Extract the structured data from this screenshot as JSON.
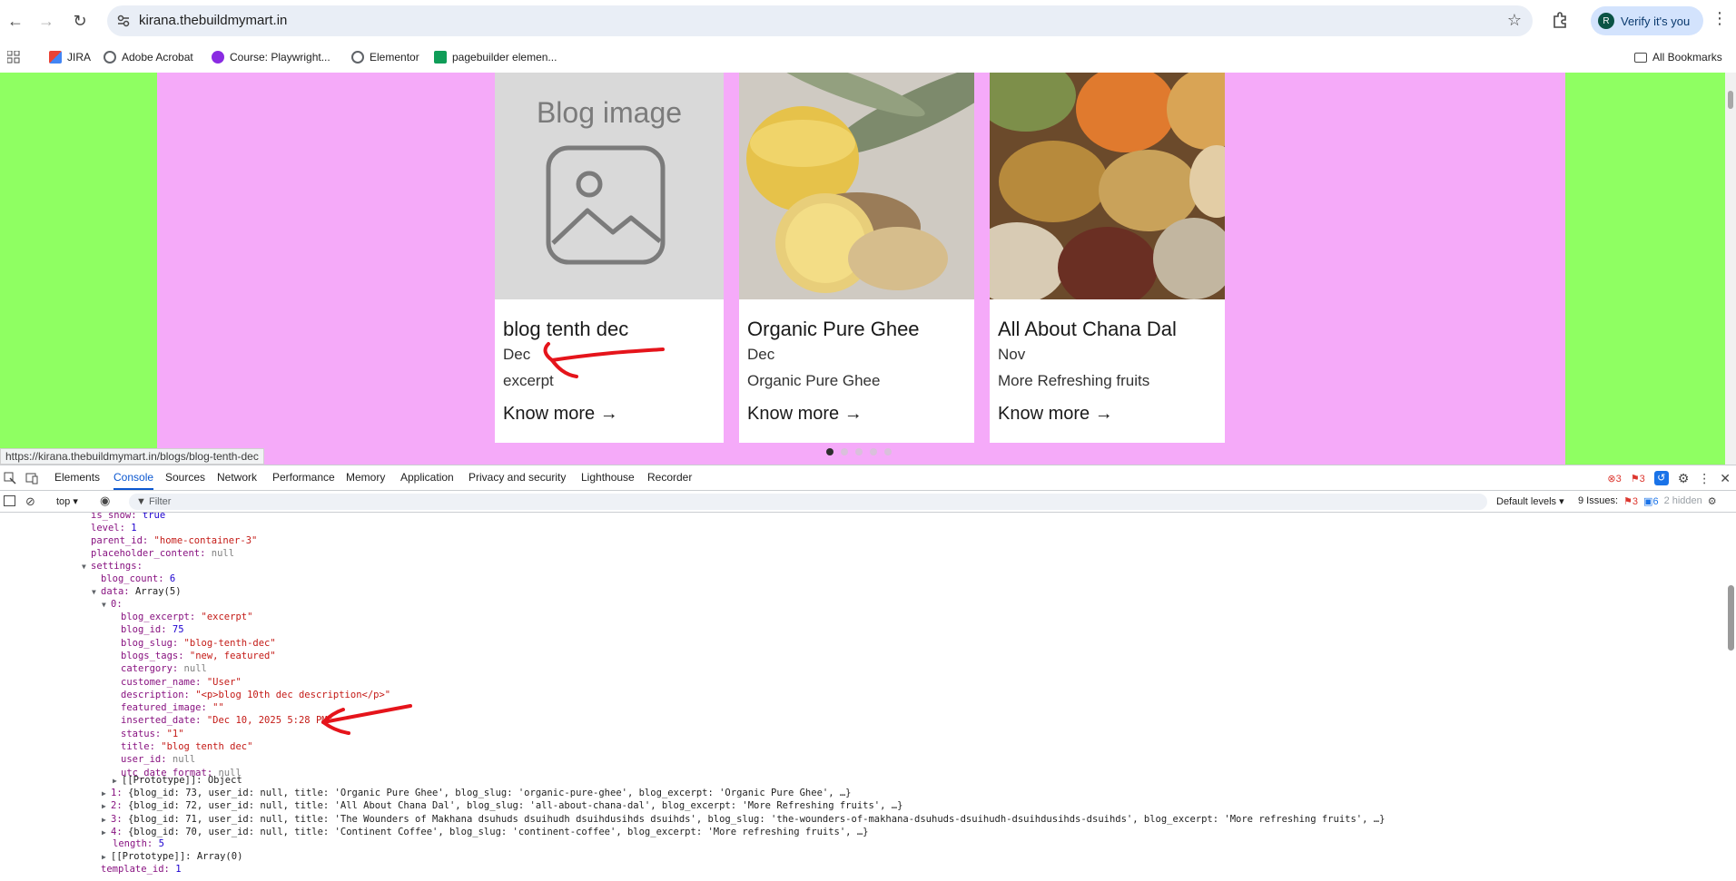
{
  "browser": {
    "url": "kirana.thebuildmymart.in",
    "verify_label": "Verify it's you",
    "avatar_letter": "R",
    "bookmarks": [
      "JIRA",
      "Adobe Acrobat",
      "Course: Playwright...",
      "Elementor",
      "pagebuilder elemen..."
    ],
    "all_bookmarks": "All Bookmarks",
    "status_url": "https://kirana.thebuildmymart.in/blogs/blog-tenth-dec"
  },
  "page": {
    "placeholder_image_text": "Blog image",
    "know_more": "Know more →",
    "cards": [
      {
        "title": "blog tenth dec",
        "month": "Dec",
        "excerpt": "excerpt"
      },
      {
        "title": "Organic Pure Ghee",
        "month": "Dec",
        "excerpt": "Organic Pure Ghee"
      },
      {
        "title": "All About Chana Dal",
        "month": "Nov",
        "excerpt": "More Refreshing fruits"
      }
    ],
    "carousel_dots": 5,
    "carousel_active": 0
  },
  "devtools": {
    "tabs": [
      "Elements",
      "Console",
      "Sources",
      "Network",
      "Performance",
      "Memory",
      "Application",
      "Privacy and security",
      "Lighthouse",
      "Recorder"
    ],
    "active_tab": "Console",
    "error_count": "3",
    "warning_count": "3",
    "context": "top",
    "filter_placeholder": "Filter",
    "default_levels": "Default levels",
    "issues_label": "9 Issues:",
    "issues_err": "3",
    "issues_info": "6",
    "hidden": "2 hidden",
    "console": {
      "is_show_key": "is_show:",
      "is_show_val": "true",
      "level_key": "level:",
      "level_val": "1",
      "parent_key": "parent_id:",
      "parent_val": "\"home-container-3\"",
      "placeholder_key": "placeholder_content:",
      "placeholder_val": "null",
      "settings_key": "settings:",
      "blog_count_key": "blog_count:",
      "blog_count_val": "6",
      "data_key": "data:",
      "data_val": "Array(5)",
      "zero_key": "0:",
      "fields": [
        {
          "k": "blog_excerpt:",
          "v": "\"excerpt\"",
          "t": "s"
        },
        {
          "k": "blog_id:",
          "v": "75",
          "t": "n"
        },
        {
          "k": "blog_slug:",
          "v": "\"blog-tenth-dec\"",
          "t": "s"
        },
        {
          "k": "blogs_tags:",
          "v": "\"new, featured\"",
          "t": "s"
        },
        {
          "k": "catergory:",
          "v": "null",
          "t": "nl"
        },
        {
          "k": "customer_name:",
          "v": "\"User\"",
          "t": "s"
        },
        {
          "k": "description:",
          "v": "\"<p>blog 10th dec description</p>\"",
          "t": "s"
        },
        {
          "k": "featured_image:",
          "v": "\"\"",
          "t": "s"
        },
        {
          "k": "inserted_date:",
          "v": "\"Dec 10, 2025 5:28 PM\"",
          "t": "s"
        },
        {
          "k": "status:",
          "v": "\"1\"",
          "t": "s"
        },
        {
          "k": "title:",
          "v": "\"blog tenth dec\"",
          "t": "s"
        },
        {
          "k": "user_id:",
          "v": "null",
          "t": "nl"
        },
        {
          "k": "utc_date_format:",
          "v": "null",
          "t": "nl"
        }
      ],
      "proto_obj": "[[Prototype]]: Object",
      "items": [
        {
          "idx": "1:",
          "body": "{blog_id: 73, user_id: null, title: 'Organic Pure Ghee', blog_slug: 'organic-pure-ghee', blog_excerpt: 'Organic Pure Ghee', …}"
        },
        {
          "idx": "2:",
          "body": "{blog_id: 72, user_id: null, title: 'All About Chana Dal', blog_slug: 'all-about-chana-dal', blog_excerpt: 'More Refreshing fruits', …}"
        },
        {
          "idx": "3:",
          "body": "{blog_id: 71, user_id: null, title: 'The Wounders of Makhana dsuhuds dsuihudh dsuihdusihds dsuihds', blog_slug: 'the-wounders-of-makhana-dsuhuds-dsuihudh-dsuihdusihds-dsuihds', blog_excerpt: 'More refreshing fruits', …}"
        },
        {
          "idx": "4:",
          "body": "{blog_id: 70, user_id: null, title: 'Continent Coffee', blog_slug: 'continent-coffee', blog_excerpt: 'More refreshing fruits', …}"
        }
      ],
      "length_key": "length:",
      "length_val": "5",
      "proto_arr": "[[Prototype]]: Array(0)",
      "template_key": "template_id:",
      "template_val": "1"
    }
  },
  "colors": {
    "page_bg": "#8fff62",
    "container_bg": "#f5aaf9",
    "accent": "#0b57d0",
    "annotation": "#e5141b"
  }
}
